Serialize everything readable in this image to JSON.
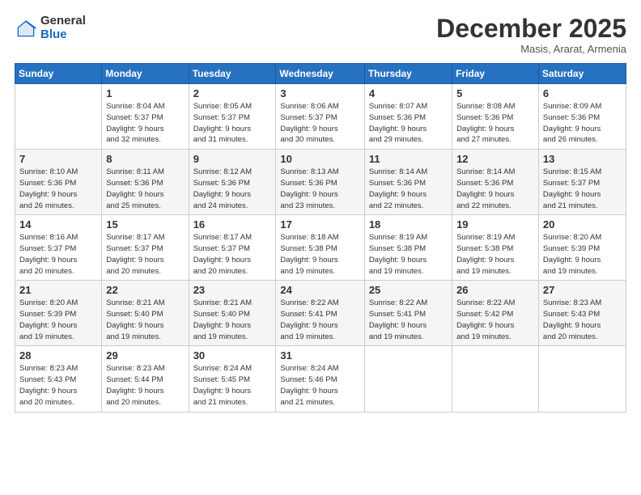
{
  "logo": {
    "general": "General",
    "blue": "Blue"
  },
  "header": {
    "month": "December 2025",
    "location": "Masis, Ararat, Armenia"
  },
  "weekdays": [
    "Sunday",
    "Monday",
    "Tuesday",
    "Wednesday",
    "Thursday",
    "Friday",
    "Saturday"
  ],
  "weeks": [
    [
      {
        "day": "",
        "info": ""
      },
      {
        "day": "1",
        "info": "Sunrise: 8:04 AM\nSunset: 5:37 PM\nDaylight: 9 hours\nand 32 minutes."
      },
      {
        "day": "2",
        "info": "Sunrise: 8:05 AM\nSunset: 5:37 PM\nDaylight: 9 hours\nand 31 minutes."
      },
      {
        "day": "3",
        "info": "Sunrise: 8:06 AM\nSunset: 5:37 PM\nDaylight: 9 hours\nand 30 minutes."
      },
      {
        "day": "4",
        "info": "Sunrise: 8:07 AM\nSunset: 5:36 PM\nDaylight: 9 hours\nand 29 minutes."
      },
      {
        "day": "5",
        "info": "Sunrise: 8:08 AM\nSunset: 5:36 PM\nDaylight: 9 hours\nand 27 minutes."
      },
      {
        "day": "6",
        "info": "Sunrise: 8:09 AM\nSunset: 5:36 PM\nDaylight: 9 hours\nand 26 minutes."
      }
    ],
    [
      {
        "day": "7",
        "info": "Sunrise: 8:10 AM\nSunset: 5:36 PM\nDaylight: 9 hours\nand 26 minutes."
      },
      {
        "day": "8",
        "info": "Sunrise: 8:11 AM\nSunset: 5:36 PM\nDaylight: 9 hours\nand 25 minutes."
      },
      {
        "day": "9",
        "info": "Sunrise: 8:12 AM\nSunset: 5:36 PM\nDaylight: 9 hours\nand 24 minutes."
      },
      {
        "day": "10",
        "info": "Sunrise: 8:13 AM\nSunset: 5:36 PM\nDaylight: 9 hours\nand 23 minutes."
      },
      {
        "day": "11",
        "info": "Sunrise: 8:14 AM\nSunset: 5:36 PM\nDaylight: 9 hours\nand 22 minutes."
      },
      {
        "day": "12",
        "info": "Sunrise: 8:14 AM\nSunset: 5:36 PM\nDaylight: 9 hours\nand 22 minutes."
      },
      {
        "day": "13",
        "info": "Sunrise: 8:15 AM\nSunset: 5:37 PM\nDaylight: 9 hours\nand 21 minutes."
      }
    ],
    [
      {
        "day": "14",
        "info": "Sunrise: 8:16 AM\nSunset: 5:37 PM\nDaylight: 9 hours\nand 20 minutes."
      },
      {
        "day": "15",
        "info": "Sunrise: 8:17 AM\nSunset: 5:37 PM\nDaylight: 9 hours\nand 20 minutes."
      },
      {
        "day": "16",
        "info": "Sunrise: 8:17 AM\nSunset: 5:37 PM\nDaylight: 9 hours\nand 20 minutes."
      },
      {
        "day": "17",
        "info": "Sunrise: 8:18 AM\nSunset: 5:38 PM\nDaylight: 9 hours\nand 19 minutes."
      },
      {
        "day": "18",
        "info": "Sunrise: 8:19 AM\nSunset: 5:38 PM\nDaylight: 9 hours\nand 19 minutes."
      },
      {
        "day": "19",
        "info": "Sunrise: 8:19 AM\nSunset: 5:38 PM\nDaylight: 9 hours\nand 19 minutes."
      },
      {
        "day": "20",
        "info": "Sunrise: 8:20 AM\nSunset: 5:39 PM\nDaylight: 9 hours\nand 19 minutes."
      }
    ],
    [
      {
        "day": "21",
        "info": "Sunrise: 8:20 AM\nSunset: 5:39 PM\nDaylight: 9 hours\nand 19 minutes."
      },
      {
        "day": "22",
        "info": "Sunrise: 8:21 AM\nSunset: 5:40 PM\nDaylight: 9 hours\nand 19 minutes."
      },
      {
        "day": "23",
        "info": "Sunrise: 8:21 AM\nSunset: 5:40 PM\nDaylight: 9 hours\nand 19 minutes."
      },
      {
        "day": "24",
        "info": "Sunrise: 8:22 AM\nSunset: 5:41 PM\nDaylight: 9 hours\nand 19 minutes."
      },
      {
        "day": "25",
        "info": "Sunrise: 8:22 AM\nSunset: 5:41 PM\nDaylight: 9 hours\nand 19 minutes."
      },
      {
        "day": "26",
        "info": "Sunrise: 8:22 AM\nSunset: 5:42 PM\nDaylight: 9 hours\nand 19 minutes."
      },
      {
        "day": "27",
        "info": "Sunrise: 8:23 AM\nSunset: 5:43 PM\nDaylight: 9 hours\nand 20 minutes."
      }
    ],
    [
      {
        "day": "28",
        "info": "Sunrise: 8:23 AM\nSunset: 5:43 PM\nDaylight: 9 hours\nand 20 minutes."
      },
      {
        "day": "29",
        "info": "Sunrise: 8:23 AM\nSunset: 5:44 PM\nDaylight: 9 hours\nand 20 minutes."
      },
      {
        "day": "30",
        "info": "Sunrise: 8:24 AM\nSunset: 5:45 PM\nDaylight: 9 hours\nand 21 minutes."
      },
      {
        "day": "31",
        "info": "Sunrise: 8:24 AM\nSunset: 5:46 PM\nDaylight: 9 hours\nand 21 minutes."
      },
      {
        "day": "",
        "info": ""
      },
      {
        "day": "",
        "info": ""
      },
      {
        "day": "",
        "info": ""
      }
    ]
  ]
}
